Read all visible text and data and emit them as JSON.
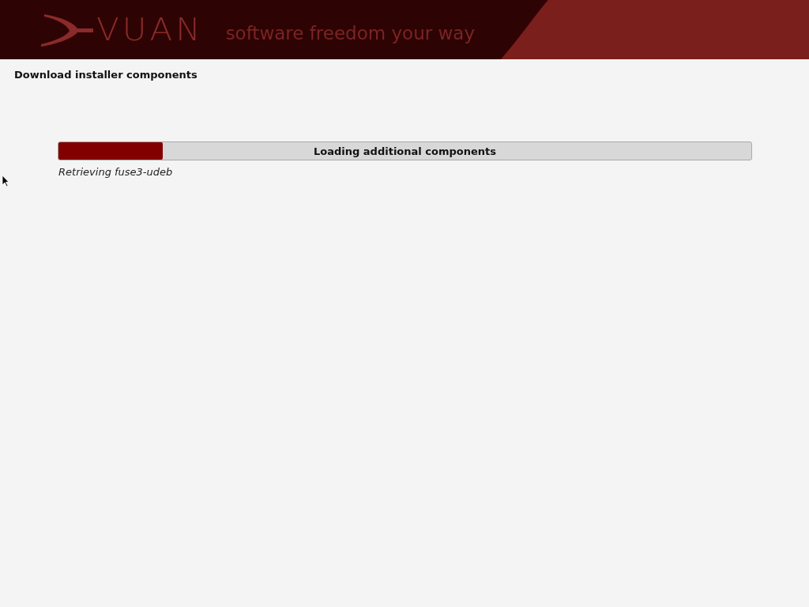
{
  "header": {
    "brand": "VUAN",
    "tagline": "software freedom your way"
  },
  "title": "Download installer components",
  "progress": {
    "label": "Loading additional components",
    "level": 0.15
  },
  "status": "Retrieving fuse3-udeb"
}
